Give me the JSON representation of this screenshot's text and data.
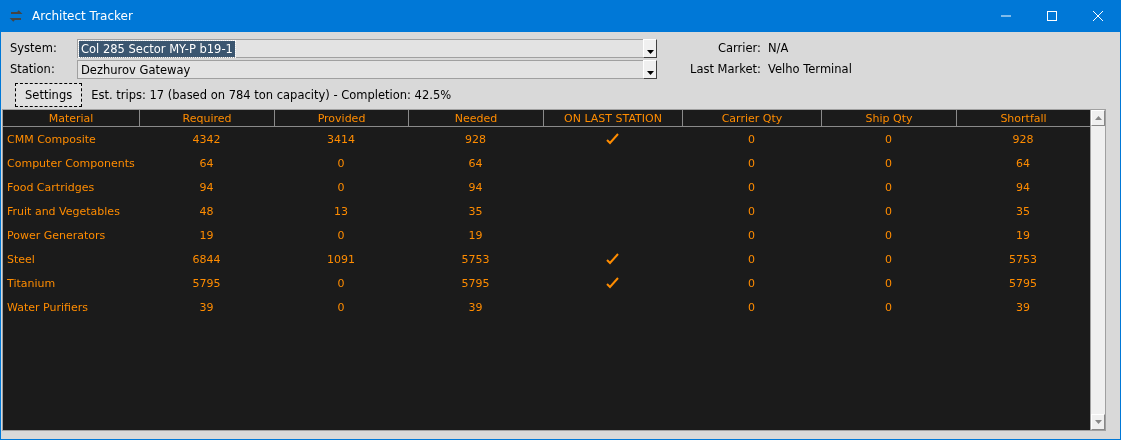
{
  "window": {
    "title": "Architect Tracker"
  },
  "system": {
    "label": "System:",
    "value": "Col 285 Sector MY-P b19-1",
    "selected": true
  },
  "station": {
    "label": "Station:",
    "value": "Dezhurov Gateway",
    "selected": false
  },
  "carrier": {
    "label": "Carrier:",
    "value": "N/A"
  },
  "last_market": {
    "label": "Last Market:",
    "value": "Velho Terminal"
  },
  "settings_button": "Settings",
  "summary": "Est. trips: 17 (based on 784 ton capacity) - Completion: 42.5%",
  "table": {
    "columns": [
      "Material",
      "Required",
      "Provided",
      "Needed",
      "ON LAST STATION",
      "Carrier Qty",
      "Ship Qty",
      "Shortfall"
    ],
    "rows": [
      {
        "material": "CMM Composite",
        "required": "4342",
        "provided": "3414",
        "needed": "928",
        "on_last_station": true,
        "carrier_qty": "0",
        "ship_qty": "0",
        "shortfall": "928"
      },
      {
        "material": "Computer Components",
        "required": "64",
        "provided": "0",
        "needed": "64",
        "on_last_station": false,
        "carrier_qty": "0",
        "ship_qty": "0",
        "shortfall": "64"
      },
      {
        "material": "Food Cartridges",
        "required": "94",
        "provided": "0",
        "needed": "94",
        "on_last_station": false,
        "carrier_qty": "0",
        "ship_qty": "0",
        "shortfall": "94"
      },
      {
        "material": "Fruit and Vegetables",
        "required": "48",
        "provided": "13",
        "needed": "35",
        "on_last_station": false,
        "carrier_qty": "0",
        "ship_qty": "0",
        "shortfall": "35"
      },
      {
        "material": "Power Generators",
        "required": "19",
        "provided": "0",
        "needed": "19",
        "on_last_station": false,
        "carrier_qty": "0",
        "ship_qty": "0",
        "shortfall": "19"
      },
      {
        "material": "Steel",
        "required": "6844",
        "provided": "1091",
        "needed": "5753",
        "on_last_station": true,
        "carrier_qty": "0",
        "ship_qty": "0",
        "shortfall": "5753"
      },
      {
        "material": "Titanium",
        "required": "5795",
        "provided": "0",
        "needed": "5795",
        "on_last_station": true,
        "carrier_qty": "0",
        "ship_qty": "0",
        "shortfall": "5795"
      },
      {
        "material": "Water Purifiers",
        "required": "39",
        "provided": "0",
        "needed": "39",
        "on_last_station": false,
        "carrier_qty": "0",
        "ship_qty": "0",
        "shortfall": "39"
      }
    ]
  }
}
